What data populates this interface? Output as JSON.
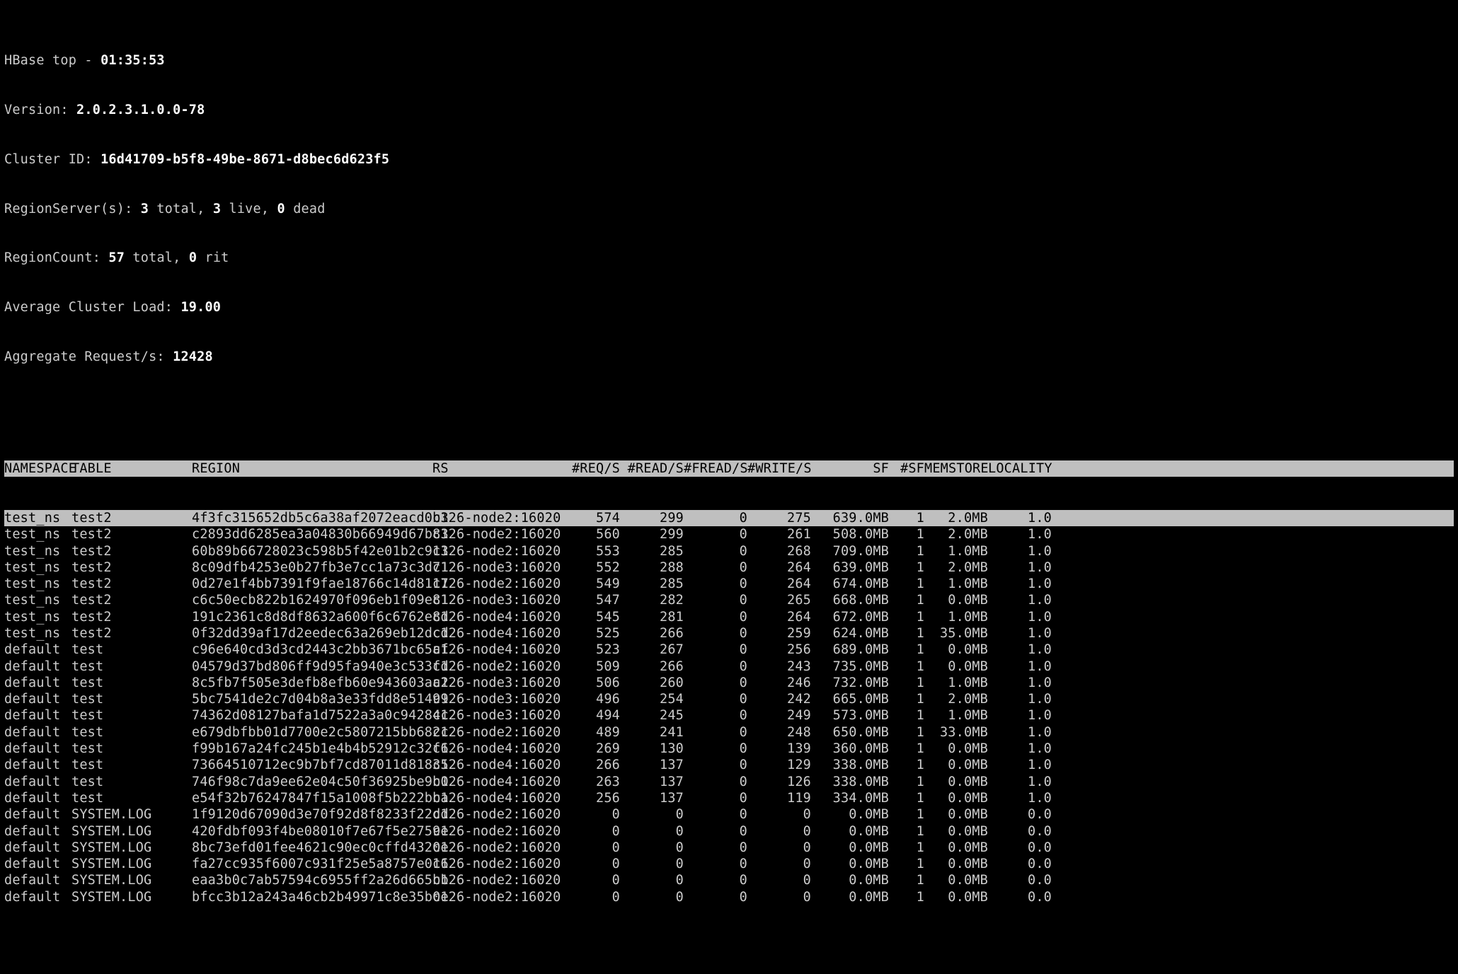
{
  "header": {
    "title_prefix": "HBase top - ",
    "time": "01:35:53",
    "version_label": "Version: ",
    "version": "2.0.2.3.1.0.0-78",
    "cluster_id_label": "Cluster ID: ",
    "cluster_id": "16d41709-b5f8-49be-8671-d8bec6d623f5",
    "rs_label": "RegionServer(s): ",
    "rs_total": "3",
    "rs_total_suffix": " total, ",
    "rs_live": "3",
    "rs_live_suffix": " live, ",
    "rs_dead": "0",
    "rs_dead_suffix": " dead",
    "regioncount_label": "RegionCount: ",
    "regioncount_total": "57",
    "regioncount_total_suffix": " total, ",
    "regioncount_rit": "0",
    "regioncount_rit_suffix": " rit",
    "avg_load_label": "Average Cluster Load: ",
    "avg_load": "19.00",
    "agg_req_label": "Aggregate Request/s: ",
    "agg_req": "12428"
  },
  "columns": {
    "ns": "NAMESPACE",
    "table": "TABLE",
    "region": "REGION",
    "rs": "RS",
    "reqs": "#REQ/S",
    "reads": "#READ/S",
    "freads": "#FREAD/S",
    "writes": "#WRITE/S",
    "sf": "SF",
    "nsf": "#SF",
    "mem": "MEMSTORE",
    "loc": "LOCALITY"
  },
  "selected_index": 0,
  "rows": [
    {
      "ns": "test_ns",
      "table": "test2",
      "region": "4f3fc315652db5c6a38af2072eacd0b3",
      "rs": "c126-node2:16020",
      "reqs": "574",
      "reads": "299",
      "freads": "0",
      "writes": "275",
      "sf": "639.0MB",
      "nsf": "1",
      "mem": "2.0MB",
      "loc": "1.0"
    },
    {
      "ns": "test_ns",
      "table": "test2",
      "region": "c2893dd6285ea3a04830b66949d67b83",
      "rs": "c126-node2:16020",
      "reqs": "560",
      "reads": "299",
      "freads": "0",
      "writes": "261",
      "sf": "508.0MB",
      "nsf": "1",
      "mem": "2.0MB",
      "loc": "1.0"
    },
    {
      "ns": "test_ns",
      "table": "test2",
      "region": "60b89b66728023c598b5f42e01b2c913",
      "rs": "c126-node2:16020",
      "reqs": "553",
      "reads": "285",
      "freads": "0",
      "writes": "268",
      "sf": "709.0MB",
      "nsf": "1",
      "mem": "1.0MB",
      "loc": "1.0"
    },
    {
      "ns": "test_ns",
      "table": "test2",
      "region": "8c09dfb4253e0b27fb3e7cc1a73c3d71",
      "rs": "c126-node3:16020",
      "reqs": "552",
      "reads": "288",
      "freads": "0",
      "writes": "264",
      "sf": "639.0MB",
      "nsf": "1",
      "mem": "2.0MB",
      "loc": "1.0"
    },
    {
      "ns": "test_ns",
      "table": "test2",
      "region": "0d27e1f4bb7391f9fae18766c14d8117",
      "rs": "c126-node2:16020",
      "reqs": "549",
      "reads": "285",
      "freads": "0",
      "writes": "264",
      "sf": "674.0MB",
      "nsf": "1",
      "mem": "1.0MB",
      "loc": "1.0"
    },
    {
      "ns": "test_ns",
      "table": "test2",
      "region": "c6c50ecb822b1624970f096eb1f09e81",
      "rs": "c126-node3:16020",
      "reqs": "547",
      "reads": "282",
      "freads": "0",
      "writes": "265",
      "sf": "668.0MB",
      "nsf": "1",
      "mem": "0.0MB",
      "loc": "1.0"
    },
    {
      "ns": "test_ns",
      "table": "test2",
      "region": "191c2361c8d8df8632a600f6c6762e8d",
      "rs": "c126-node4:16020",
      "reqs": "545",
      "reads": "281",
      "freads": "0",
      "writes": "264",
      "sf": "672.0MB",
      "nsf": "1",
      "mem": "1.0MB",
      "loc": "1.0"
    },
    {
      "ns": "test_ns",
      "table": "test2",
      "region": "0f32dd39af17d2eedec63a269eb12dcd",
      "rs": "c126-node4:16020",
      "reqs": "525",
      "reads": "266",
      "freads": "0",
      "writes": "259",
      "sf": "624.0MB",
      "nsf": "1",
      "mem": "35.0MB",
      "loc": "1.0"
    },
    {
      "ns": "default",
      "table": "test",
      "region": "c96e640cd3d3cd2443c2bb3671bc65af",
      "rs": "c126-node4:16020",
      "reqs": "523",
      "reads": "267",
      "freads": "0",
      "writes": "256",
      "sf": "689.0MB",
      "nsf": "1",
      "mem": "0.0MB",
      "loc": "1.0"
    },
    {
      "ns": "default",
      "table": "test",
      "region": "04579d37bd806ff9d95fa940e3c533fd",
      "rs": "c126-node2:16020",
      "reqs": "509",
      "reads": "266",
      "freads": "0",
      "writes": "243",
      "sf": "735.0MB",
      "nsf": "1",
      "mem": "0.0MB",
      "loc": "1.0"
    },
    {
      "ns": "default",
      "table": "test",
      "region": "8c5fb7f505e3defb8efb60e943603aa2",
      "rs": "c126-node3:16020",
      "reqs": "506",
      "reads": "260",
      "freads": "0",
      "writes": "246",
      "sf": "732.0MB",
      "nsf": "1",
      "mem": "1.0MB",
      "loc": "1.0"
    },
    {
      "ns": "default",
      "table": "test",
      "region": "5bc7541de2c7d04b8a3e33fdd8e51499",
      "rs": "c126-node3:16020",
      "reqs": "496",
      "reads": "254",
      "freads": "0",
      "writes": "242",
      "sf": "665.0MB",
      "nsf": "1",
      "mem": "2.0MB",
      "loc": "1.0"
    },
    {
      "ns": "default",
      "table": "test",
      "region": "74362d08127bafa1d7522a3a0c94284c",
      "rs": "c126-node3:16020",
      "reqs": "494",
      "reads": "245",
      "freads": "0",
      "writes": "249",
      "sf": "573.0MB",
      "nsf": "1",
      "mem": "1.0MB",
      "loc": "1.0"
    },
    {
      "ns": "default",
      "table": "test",
      "region": "e679dbfbb01d7700e2c5807215bb682c",
      "rs": "c126-node2:16020",
      "reqs": "489",
      "reads": "241",
      "freads": "0",
      "writes": "248",
      "sf": "650.0MB",
      "nsf": "1",
      "mem": "33.0MB",
      "loc": "1.0"
    },
    {
      "ns": "default",
      "table": "test",
      "region": "f99b167a24fc245b1e4b4b52912c32f6",
      "rs": "c126-node4:16020",
      "reqs": "269",
      "reads": "130",
      "freads": "0",
      "writes": "139",
      "sf": "360.0MB",
      "nsf": "1",
      "mem": "0.0MB",
      "loc": "1.0"
    },
    {
      "ns": "default",
      "table": "test",
      "region": "73664510712ec9b7bf7cd87011d81835",
      "rs": "c126-node4:16020",
      "reqs": "266",
      "reads": "137",
      "freads": "0",
      "writes": "129",
      "sf": "338.0MB",
      "nsf": "1",
      "mem": "0.0MB",
      "loc": "1.0"
    },
    {
      "ns": "default",
      "table": "test",
      "region": "746f98c7da9ee62e04c50f36925be9b0",
      "rs": "c126-node4:16020",
      "reqs": "263",
      "reads": "137",
      "freads": "0",
      "writes": "126",
      "sf": "338.0MB",
      "nsf": "1",
      "mem": "0.0MB",
      "loc": "1.0"
    },
    {
      "ns": "default",
      "table": "test",
      "region": "e54f32b76247847f15a1008f5b222bba",
      "rs": "c126-node4:16020",
      "reqs": "256",
      "reads": "137",
      "freads": "0",
      "writes": "119",
      "sf": "334.0MB",
      "nsf": "1",
      "mem": "0.0MB",
      "loc": "1.0"
    },
    {
      "ns": "default",
      "table": "SYSTEM.LOG",
      "region": "1f9120d67090d3e70f92d8f8233f22dd",
      "rs": "c126-node2:16020",
      "reqs": "0",
      "reads": "0",
      "freads": "0",
      "writes": "0",
      "sf": "0.0MB",
      "nsf": "1",
      "mem": "0.0MB",
      "loc": "0.0"
    },
    {
      "ns": "default",
      "table": "SYSTEM.LOG",
      "region": "420fdbf093f4be08010f7e67f5e2759e",
      "rs": "c126-node2:16020",
      "reqs": "0",
      "reads": "0",
      "freads": "0",
      "writes": "0",
      "sf": "0.0MB",
      "nsf": "1",
      "mem": "0.0MB",
      "loc": "0.0"
    },
    {
      "ns": "default",
      "table": "SYSTEM.LOG",
      "region": "8bc73efd01fee4621c90ec0cffd4320e",
      "rs": "c126-node2:16020",
      "reqs": "0",
      "reads": "0",
      "freads": "0",
      "writes": "0",
      "sf": "0.0MB",
      "nsf": "1",
      "mem": "0.0MB",
      "loc": "0.0"
    },
    {
      "ns": "default",
      "table": "SYSTEM.LOG",
      "region": "fa27cc935f6007c931f25e5a8757e016",
      "rs": "c126-node2:16020",
      "reqs": "0",
      "reads": "0",
      "freads": "0",
      "writes": "0",
      "sf": "0.0MB",
      "nsf": "1",
      "mem": "0.0MB",
      "loc": "0.0"
    },
    {
      "ns": "default",
      "table": "SYSTEM.LOG",
      "region": "eaa3b0c7ab57594c6955ff2a26d665bb",
      "rs": "c126-node2:16020",
      "reqs": "0",
      "reads": "0",
      "freads": "0",
      "writes": "0",
      "sf": "0.0MB",
      "nsf": "1",
      "mem": "0.0MB",
      "loc": "0.0"
    },
    {
      "ns": "default",
      "table": "SYSTEM.LOG",
      "region": "bfcc3b12a243a46cb2b49971c8e35b0e",
      "rs": "c126-node2:16020",
      "reqs": "0",
      "reads": "0",
      "freads": "0",
      "writes": "0",
      "sf": "0.0MB",
      "nsf": "1",
      "mem": "0.0MB",
      "loc": "0.0"
    }
  ]
}
